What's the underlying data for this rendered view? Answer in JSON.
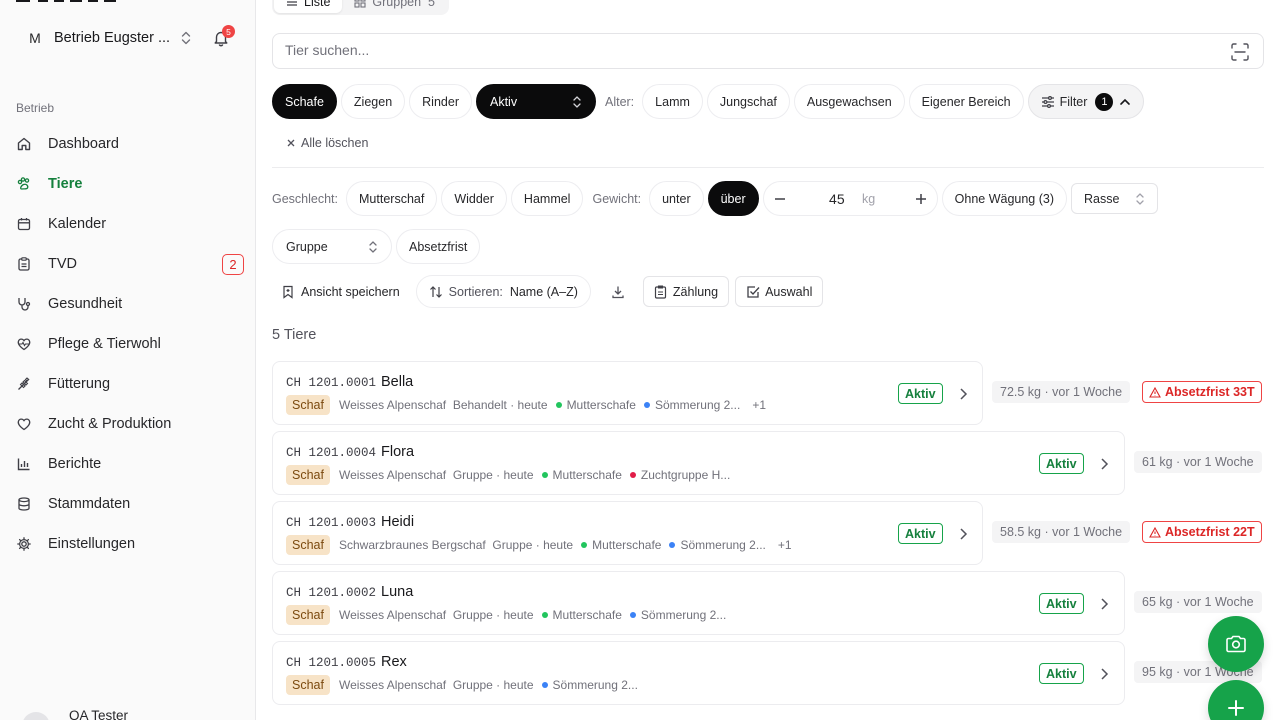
{
  "sidebar": {
    "farm": {
      "initial": "M",
      "name": "Betrieb Eugster ..."
    },
    "notifications_count": "5",
    "section_label": "Betrieb",
    "items": [
      {
        "label": "Dashboard",
        "icon": "home-icon"
      },
      {
        "label": "Tiere",
        "icon": "paw-icon",
        "active": true
      },
      {
        "label": "Kalender",
        "icon": "calendar-icon"
      },
      {
        "label": "TVD",
        "icon": "clipboard-icon",
        "badge": "2"
      },
      {
        "label": "Gesundheit",
        "icon": "stethoscope-icon"
      },
      {
        "label": "Pflege & Tierwohl",
        "icon": "heart-pulse-icon"
      },
      {
        "label": "Fütterung",
        "icon": "wheat-icon"
      },
      {
        "label": "Zucht & Produktion",
        "icon": "heart-icon"
      },
      {
        "label": "Berichte",
        "icon": "bar-chart-icon"
      },
      {
        "label": "Stammdaten",
        "icon": "database-icon"
      },
      {
        "label": "Einstellungen",
        "icon": "gear-icon"
      }
    ],
    "user": {
      "name": "QA Tester"
    }
  },
  "main": {
    "view_tabs": [
      {
        "label": "Liste",
        "active": true
      },
      {
        "label": "Gruppen",
        "count": "5"
      }
    ],
    "search": {
      "placeholder": "Tier suchen..."
    },
    "species_filters": [
      "Schafe",
      "Ziegen",
      "Rinder"
    ],
    "status_select": "Aktiv",
    "age_label": "Alter:",
    "age_filters": [
      "Lamm",
      "Jungschaf",
      "Ausgewachsen",
      "Eigener Bereich"
    ],
    "filter_toggle": {
      "label": "Filter",
      "count": "1"
    },
    "clear_all": "Alle löschen",
    "sex_label": "Geschlecht:",
    "sex_filters": [
      "Mutterschaf",
      "Widder",
      "Hammel"
    ],
    "weight_label": "Gewicht:",
    "weight_ops": [
      "unter",
      "über"
    ],
    "weight_value": "45",
    "weight_unit": "kg",
    "no_weighing": "Ohne Wägung (3)",
    "breed_select": "Rasse",
    "group_select": "Gruppe",
    "withdrawal": "Absetzfrist",
    "toolbar": {
      "save_view": "Ansicht speichern",
      "sort_label": "Sortieren:",
      "sort_value": "Name (A–Z)",
      "count_btn": "Zählung",
      "select_btn": "Auswahl"
    },
    "result_count": "5 Tiere",
    "animals": [
      {
        "id": "CH 1201.0001",
        "name": "Bella",
        "species": "Schaf",
        "breed": "Weisses Alpenschaf",
        "activity": "Behandelt · heute",
        "tags": [
          {
            "label": "Mutterschafe",
            "color": "#22c55e"
          },
          {
            "label": "Sömmerung 2...",
            "color": "#3b82f6"
          }
        ],
        "more": "+1",
        "status": "Aktiv",
        "weight": "72.5 kg · vor 1 Woche",
        "alert": "Absetzfrist 33T"
      },
      {
        "id": "CH 1201.0004",
        "name": "Flora",
        "species": "Schaf",
        "breed": "Weisses Alpenschaf",
        "activity": "Gruppe · heute",
        "tags": [
          {
            "label": "Mutterschafe",
            "color": "#22c55e"
          },
          {
            "label": "Zuchtgruppe H...",
            "color": "#e11d48"
          }
        ],
        "status": "Aktiv",
        "weight": "61 kg · vor 1 Woche"
      },
      {
        "id": "CH 1201.0003",
        "name": "Heidi",
        "species": "Schaf",
        "breed": "Schwarzbraunes Bergschaf",
        "activity": "Gruppe · heute",
        "tags": [
          {
            "label": "Mutterschafe",
            "color": "#22c55e"
          },
          {
            "label": "Sömmerung 2...",
            "color": "#3b82f6"
          }
        ],
        "more": "+1",
        "status": "Aktiv",
        "weight": "58.5 kg · vor 1 Woche",
        "alert": "Absetzfrist 22T"
      },
      {
        "id": "CH 1201.0002",
        "name": "Luna",
        "species": "Schaf",
        "breed": "Weisses Alpenschaf",
        "activity": "Gruppe · heute",
        "tags": [
          {
            "label": "Mutterschafe",
            "color": "#22c55e"
          },
          {
            "label": "Sömmerung 2...",
            "color": "#3b82f6"
          }
        ],
        "status": "Aktiv",
        "weight": "65 kg · vor 1 Woche"
      },
      {
        "id": "CH 1201.0005",
        "name": "Rex",
        "species": "Schaf",
        "breed": "Weisses Alpenschaf",
        "activity": "Gruppe · heute",
        "tags": [
          {
            "label": "Sömmerung 2...",
            "color": "#3b82f6"
          }
        ],
        "status": "Aktiv",
        "weight": "95 kg · vor 1 Woche"
      }
    ]
  },
  "colors": {
    "accent": "#16a34a",
    "danger": "#ef4444",
    "dark": "#0b0b0c"
  }
}
